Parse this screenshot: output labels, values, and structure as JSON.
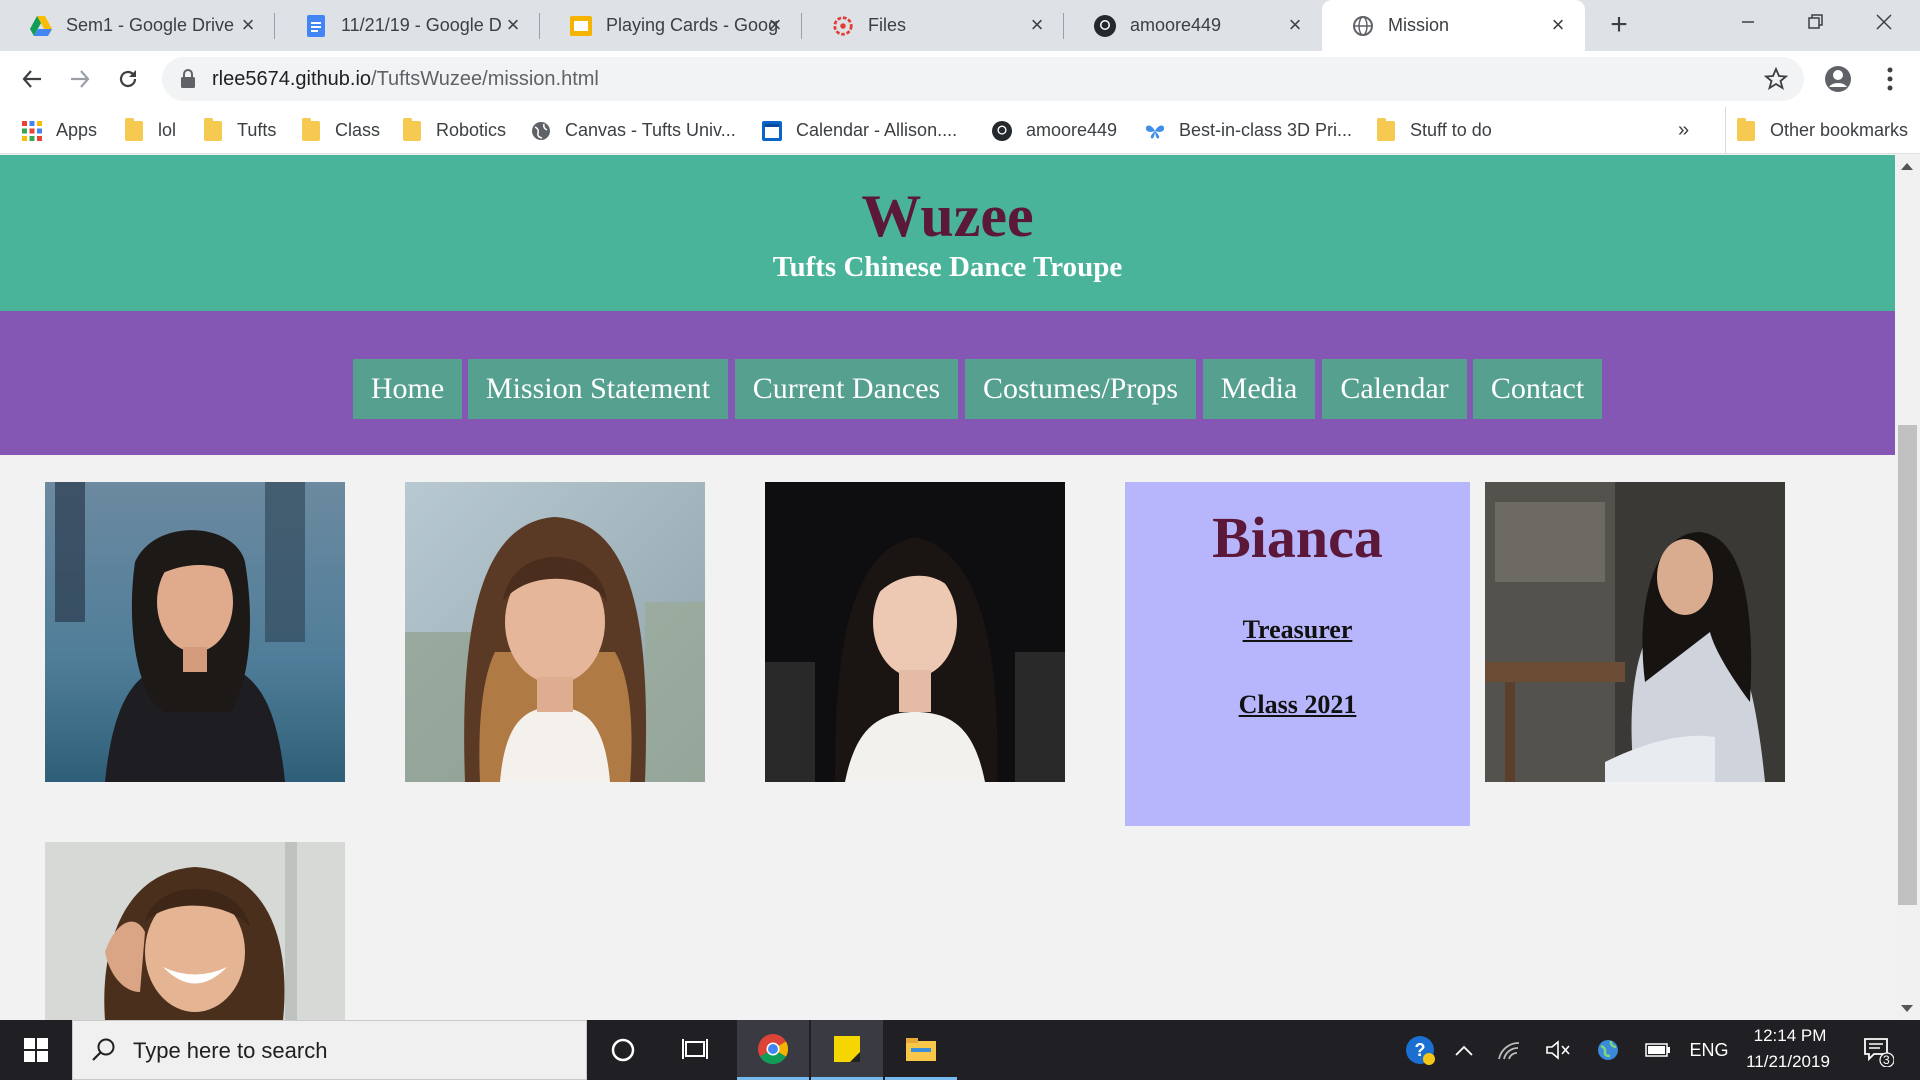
{
  "browser": {
    "tabs": [
      {
        "title": "Sem1 - Google Drive",
        "icon": "google-drive-icon"
      },
      {
        "title": "11/21/19 - Google D",
        "icon": "google-docs-icon"
      },
      {
        "title": "Playing Cards - Goog",
        "icon": "google-slides-icon"
      },
      {
        "title": "Files",
        "icon": "canvas-icon"
      },
      {
        "title": "amoore449",
        "icon": "github-icon"
      },
      {
        "title": "Mission",
        "icon": "globe-icon"
      }
    ],
    "new_tab": "+",
    "url_host": "rlee5674.github.io",
    "url_path": "/TuftsWuzee/mission.html",
    "bookmarks": [
      {
        "label": "Apps",
        "icon": "apps-grid-icon"
      },
      {
        "label": "lol",
        "icon": "folder-icon"
      },
      {
        "label": "Tufts",
        "icon": "folder-icon"
      },
      {
        "label": "Class",
        "icon": "folder-icon"
      },
      {
        "label": "Robotics",
        "icon": "folder-icon"
      },
      {
        "label": "Canvas - Tufts Univ...",
        "icon": "globe-icon"
      },
      {
        "label": "Calendar - Allison....",
        "icon": "outlook-calendar-icon"
      },
      {
        "label": "amoore449",
        "icon": "github-icon"
      },
      {
        "label": "Best-in-class 3D Pri...",
        "icon": "butterfly-icon"
      },
      {
        "label": "Stuff to do",
        "icon": "folder-icon"
      }
    ],
    "bookmarks_overflow": "»",
    "other_bookmarks": "Other bookmarks"
  },
  "site": {
    "title": "Wuzee",
    "subtitle": "Tufts Chinese Dance Troupe",
    "nav": [
      "Home",
      "Mission Statement",
      "Current Dances",
      "Costumes/Props",
      "Media",
      "Calendar",
      "Contact"
    ],
    "bio": {
      "name": "Bianca",
      "role": "Treasurer",
      "class_year": "Class 2021"
    }
  },
  "taskbar": {
    "search_placeholder": "Type here to search",
    "language": "ENG",
    "time": "12:14 PM",
    "date": "11/21/2019",
    "notifications_count": "3"
  },
  "colors": {
    "header_teal": "#4ab49b",
    "nav_purple": "#8357b3",
    "nav_button": "#56a08f",
    "title_maroon": "#5b1838",
    "bio_card": "#b7b6fc"
  }
}
